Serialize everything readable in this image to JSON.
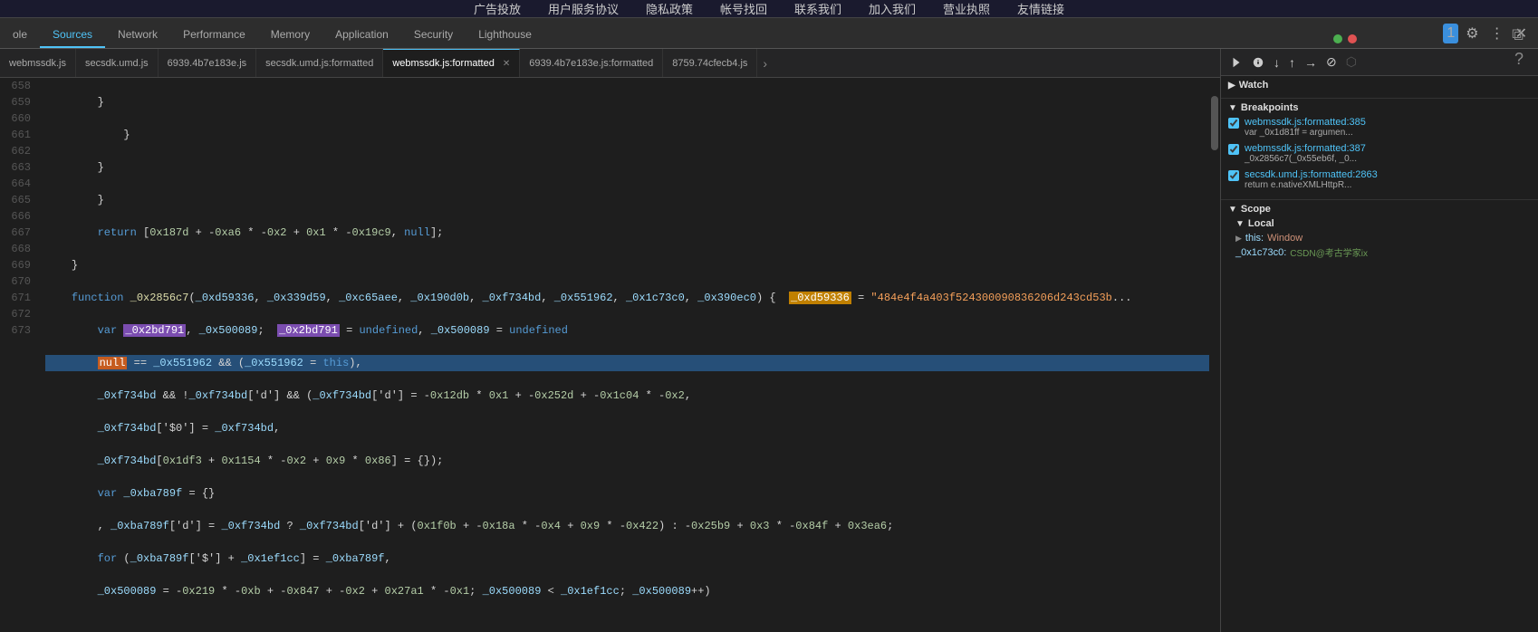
{
  "browser": {
    "dots": [
      "red",
      "green"
    ]
  },
  "website": {
    "links": [
      "广告投放",
      "用户服务协议",
      "隐私政策",
      "帐号找回",
      "联系我们",
      "加入我们",
      "营业执照",
      "友情链接"
    ]
  },
  "devtools": {
    "tabs": [
      {
        "label": "ole",
        "active": false
      },
      {
        "label": "Sources",
        "active": true
      },
      {
        "label": "Network",
        "active": false
      },
      {
        "label": "Performance",
        "active": false
      },
      {
        "label": "Memory",
        "active": false
      },
      {
        "label": "Application",
        "active": false
      },
      {
        "label": "Security",
        "active": false
      },
      {
        "label": "Lighthouse",
        "active": false
      }
    ],
    "badge": "1",
    "file_tabs": [
      {
        "label": "webmssdk.js",
        "active": false,
        "closeable": false
      },
      {
        "label": "secsdk.umd.js",
        "active": false,
        "closeable": false
      },
      {
        "label": "6939.4b7e183e.js",
        "active": false,
        "closeable": false
      },
      {
        "label": "secsdk.umd.js:formatted",
        "active": false,
        "closeable": false
      },
      {
        "label": "webmssdk.js:formatted",
        "active": true,
        "closeable": true
      },
      {
        "label": "6939.4b7e183e.js:formatted",
        "active": false,
        "closeable": false
      },
      {
        "label": "8759.74cfecb4.js",
        "active": false,
        "closeable": false
      }
    ]
  },
  "code": {
    "lines": [
      {
        "num": 658,
        "text": "        }"
      },
      {
        "num": 659,
        "text": "            }"
      },
      {
        "num": 660,
        "text": "        }"
      },
      {
        "num": 661,
        "text": "        }"
      },
      {
        "num": 662,
        "text": "        return [0x187d + -0xa6 * -0x2 + 0x1 * -0x19c9, null];"
      },
      {
        "num": 663,
        "text": "    }"
      },
      {
        "num": 664,
        "text": "    function _0x2856c7(_0xd59336, _0x339d59, _0xc65aee, _0x190d0b, _0xf734bd, _0x551962, _0x1c73c0, _0x390ec0) {"
      },
      {
        "num": 665,
        "text": "        var _0x2bd791, _0x500089;"
      },
      {
        "num": 666,
        "text": "        null == _0x551962 && (_0x551962 = this),"
      },
      {
        "num": 667,
        "text": "        _0xf734bd && !_0xf734bd['d'] && (_0xf734bd['d'] = -0x12db * 0x1 + -0x252d + -0x1c04 * -0x2,"
      },
      {
        "num": 668,
        "text": "        _0xf734bd['$0'] = _0xf734bd,"
      },
      {
        "num": 669,
        "text": "        _0xf734bd[0x1df3 + 0x1154 * -0x2 + 0x9 * 0x86] = {});"
      },
      {
        "num": 670,
        "text": "        var _0xba789f = {}"
      },
      {
        "num": 671,
        "text": "        , _0xba789f['d'] = _0xf734bd ? _0xf734bd['d'] + (0x1f0b + -0x18a * -0x4 + 0x9 * -0x422) : -0x25b9 + 0x3 * -0x84f + 0x3ea6;"
      },
      {
        "num": 672,
        "text": "        for (_0xba789f['$'] + _0x1ef1cc] = _0xba789f,"
      },
      {
        "num": 673,
        "text": "        _0x500089 = -0x219 * -0xb + -0x847 + -0x2 + 0x27a1 * -0x1; _0x500089 < _0x1ef1cc; _0x500089++)"
      }
    ],
    "highlighted_line": 666,
    "watch_label": "Watch",
    "breakpoints_label": "Breakpoints",
    "scope_label": "Scope",
    "local_label": "Local"
  },
  "right_panel": {
    "breakpoints": [
      {
        "checked": true,
        "file": "webmssdk.js:formatted:385",
        "code": "var _0x1d81ff = argumen..."
      },
      {
        "checked": true,
        "file": "webmssdk.js:formatted:387",
        "code": "_0x2856c7(_0x55eb6f, _0..."
      },
      {
        "checked": true,
        "file": "secsdk.umd.js:formatted:2863",
        "code": "return e.nativeXMLHttpR..."
      }
    ],
    "scope": {
      "local": {
        "this_val": "Window",
        "var1_key": "_0x1c73c0:",
        "var1_val": ""
      }
    }
  }
}
